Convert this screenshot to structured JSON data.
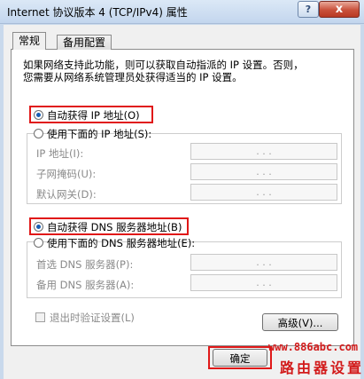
{
  "window": {
    "title": "Internet 协议版本 4 (TCP/IPv4) 属性",
    "help_label": "?",
    "close_label": "x"
  },
  "tabs": [
    {
      "label": "常规",
      "active": true
    },
    {
      "label": "备用配置",
      "active": false
    }
  ],
  "description": {
    "line1": "如果网络支持此功能，则可以获取自动指派的 IP 设置。否则，",
    "line2": "您需要从网络系统管理员处获得适当的 IP 设置。"
  },
  "ip_mode": {
    "auto_label": "自动获得 IP 地址(O)",
    "auto_selected": true,
    "manual_label": "使用下面的 IP 地址(S):",
    "manual_selected": false
  },
  "ip_fields": [
    {
      "label": "IP 地址(I):",
      "value": ".     .     ."
    },
    {
      "label": "子网掩码(U):",
      "value": ".     .     ."
    },
    {
      "label": "默认网关(D):",
      "value": ".     .     ."
    }
  ],
  "dns_mode": {
    "auto_label": "自动获得 DNS 服务器地址(B)",
    "auto_selected": true,
    "manual_label": "使用下面的 DNS 服务器地址(E):",
    "manual_selected": false
  },
  "dns_fields": [
    {
      "label": "首选 DNS 服务器(P):",
      "value": ".     .     ."
    },
    {
      "label": "备用 DNS 服务器(A):",
      "value": ".     .     ."
    }
  ],
  "validate_on_exit": {
    "label": "退出时验证设置(L)",
    "checked": false
  },
  "buttons": {
    "advanced": "高级(V)...",
    "ok": "确定"
  },
  "watermark": {
    "url": "www.886abc.com",
    "text": "路由器设置"
  },
  "colors": {
    "highlight": "#e01818",
    "accent": "#1a5fb4"
  }
}
